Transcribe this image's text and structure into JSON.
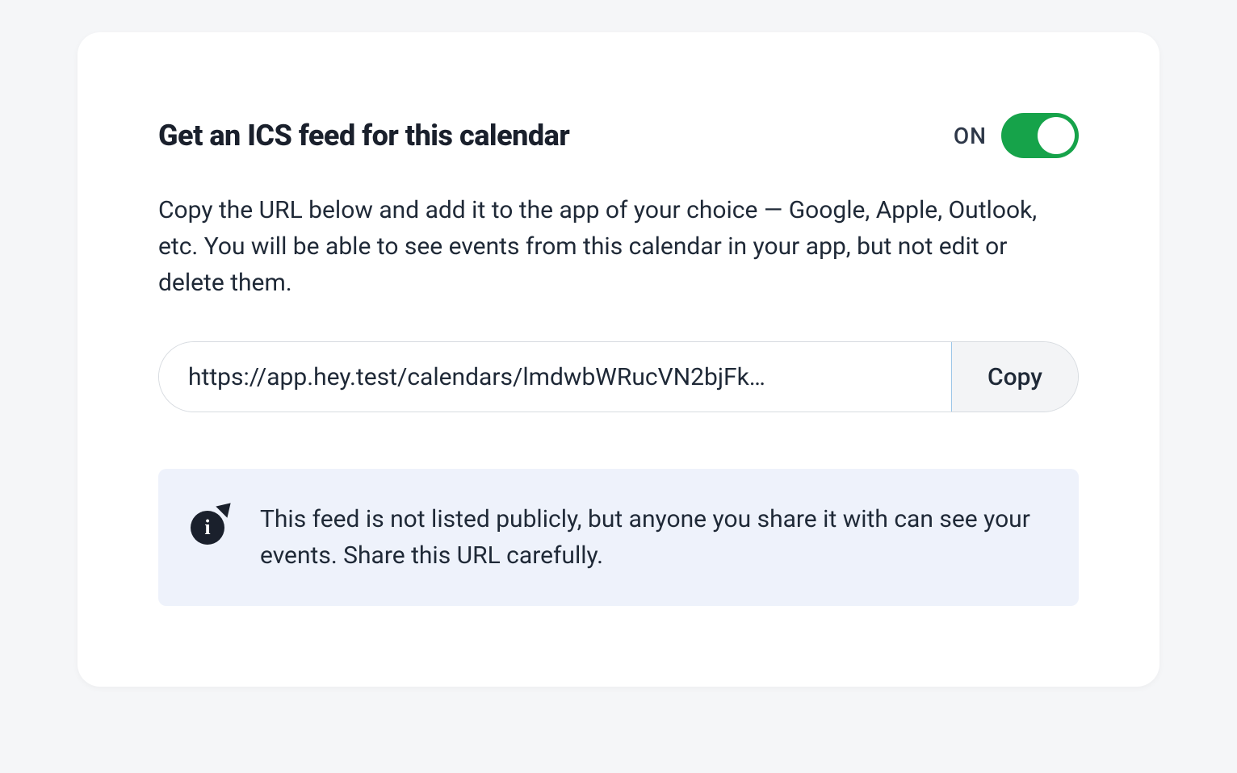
{
  "title": "Get an ICS feed for this calendar",
  "toggle": {
    "state_label": "ON",
    "on": true
  },
  "description": "Copy the URL below and add it to the app of your choice — Google, Apple, Outlook, etc. You will be able to see events from this calendar in your app, but not edit or delete them.",
  "url_field": {
    "value": "https://app.hey.test/calendars/lmdwbWRucVN2bjFk…"
  },
  "copy_button_label": "Copy",
  "info": {
    "text": "This feed is not listed publicly, but anyone you share it with can see your events. Share this URL carefully."
  }
}
